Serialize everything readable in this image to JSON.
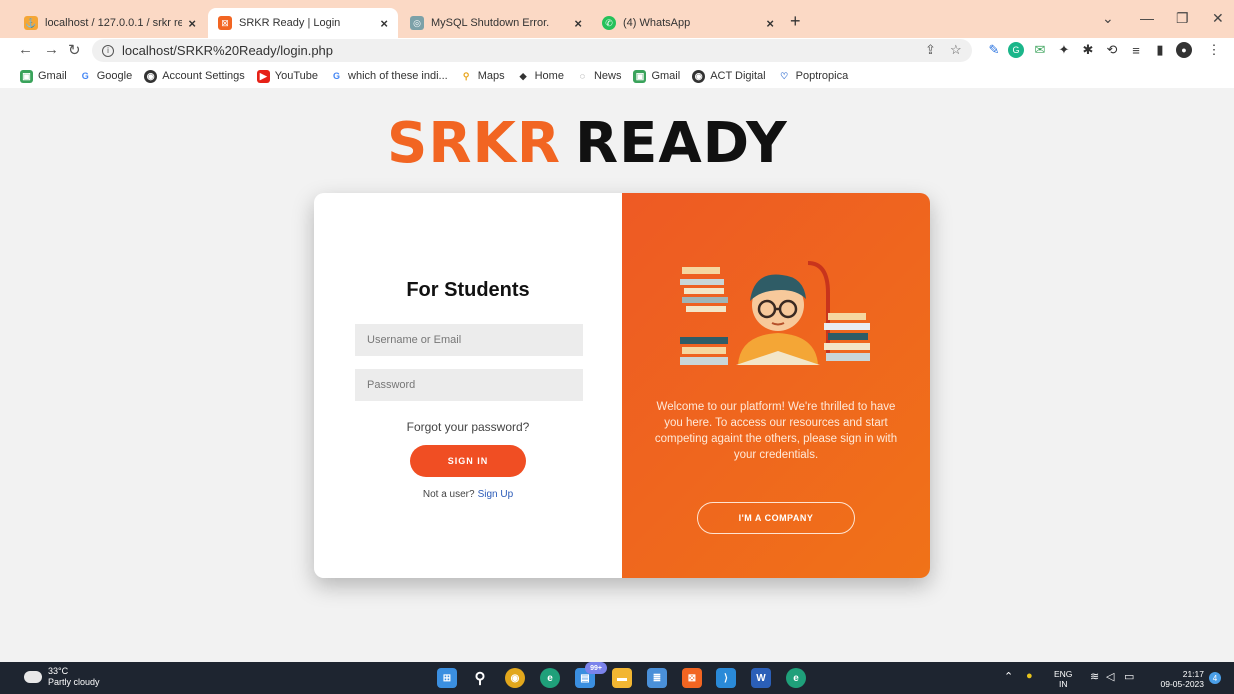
{
  "tabs": [
    {
      "title": "localhost / 127.0.0.1 / srkr ready",
      "icon": "phpmyadmin-icon"
    },
    {
      "title": "SRKR Ready | Login",
      "icon": "xampp-icon"
    },
    {
      "title": "MySQL Shutdown Error.",
      "icon": "globe-icon"
    },
    {
      "title": "(4) WhatsApp",
      "icon": "whatsapp-icon"
    }
  ],
  "address": {
    "url": "localhost/SRKR%20Ready/login.php"
  },
  "bookmarks": [
    {
      "label": "Gmail",
      "icon": "gmail-icon"
    },
    {
      "label": "Google",
      "icon": "google-icon"
    },
    {
      "label": "Account Settings",
      "icon": "chrome-icon"
    },
    {
      "label": "YouTube",
      "icon": "youtube-icon"
    },
    {
      "label": "which of these indi...",
      "icon": "google-icon"
    },
    {
      "label": "Maps",
      "icon": "maps-icon"
    },
    {
      "label": "Home",
      "icon": "home-icon"
    },
    {
      "label": "News",
      "icon": "news-icon"
    },
    {
      "label": "Gmail",
      "icon": "gmail-icon"
    },
    {
      "label": "ACT Digital",
      "icon": "chrome-icon"
    },
    {
      "label": "Poptropica",
      "icon": "poptropica-icon"
    }
  ],
  "logo": {
    "part1": "SRKR",
    "part2": "READY"
  },
  "login": {
    "title": "For Students",
    "username_placeholder": "Username or Email",
    "password_placeholder": "Password",
    "forgot": "Forgot your password?",
    "signin": "SIGN IN",
    "not_user": "Not a user?",
    "signup": "Sign Up"
  },
  "welcome_panel": {
    "text": "Welcome to our platform! We're thrilled to have you here. To access our resources and start competing againt the others, please sign in with your credentials.",
    "company_button": "I'M A COMPANY"
  },
  "taskbar": {
    "temperature": "33°C",
    "weather": "Partly cloudy",
    "lang1": "ENG",
    "lang2": "IN",
    "time": "21:17",
    "date": "09-05-2023",
    "notifications": "4",
    "store_badge": "99+"
  },
  "colors": {
    "brand_orange": "#f26522",
    "panel_orange": "#ee5a24",
    "tabstrip": "#fbd9c5"
  }
}
